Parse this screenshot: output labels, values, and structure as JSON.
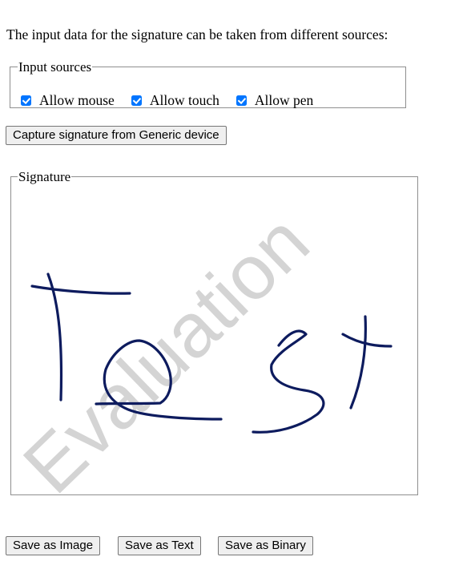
{
  "intro_text": "The input data for the signature can be taken from different sources:",
  "input_sources": {
    "legend": "Input sources",
    "options": [
      {
        "label": "Allow mouse",
        "checked": true
      },
      {
        "label": "Allow touch",
        "checked": true
      },
      {
        "label": "Allow pen",
        "checked": true
      }
    ]
  },
  "capture_button": "Capture signature from Generic device",
  "signature": {
    "legend": "Signature",
    "watermark": "Evaluation",
    "ink_color": "#0d1b5e"
  },
  "save_buttons": {
    "image": "Save as Image",
    "text": "Save as Text",
    "binary": "Save as Binary"
  }
}
